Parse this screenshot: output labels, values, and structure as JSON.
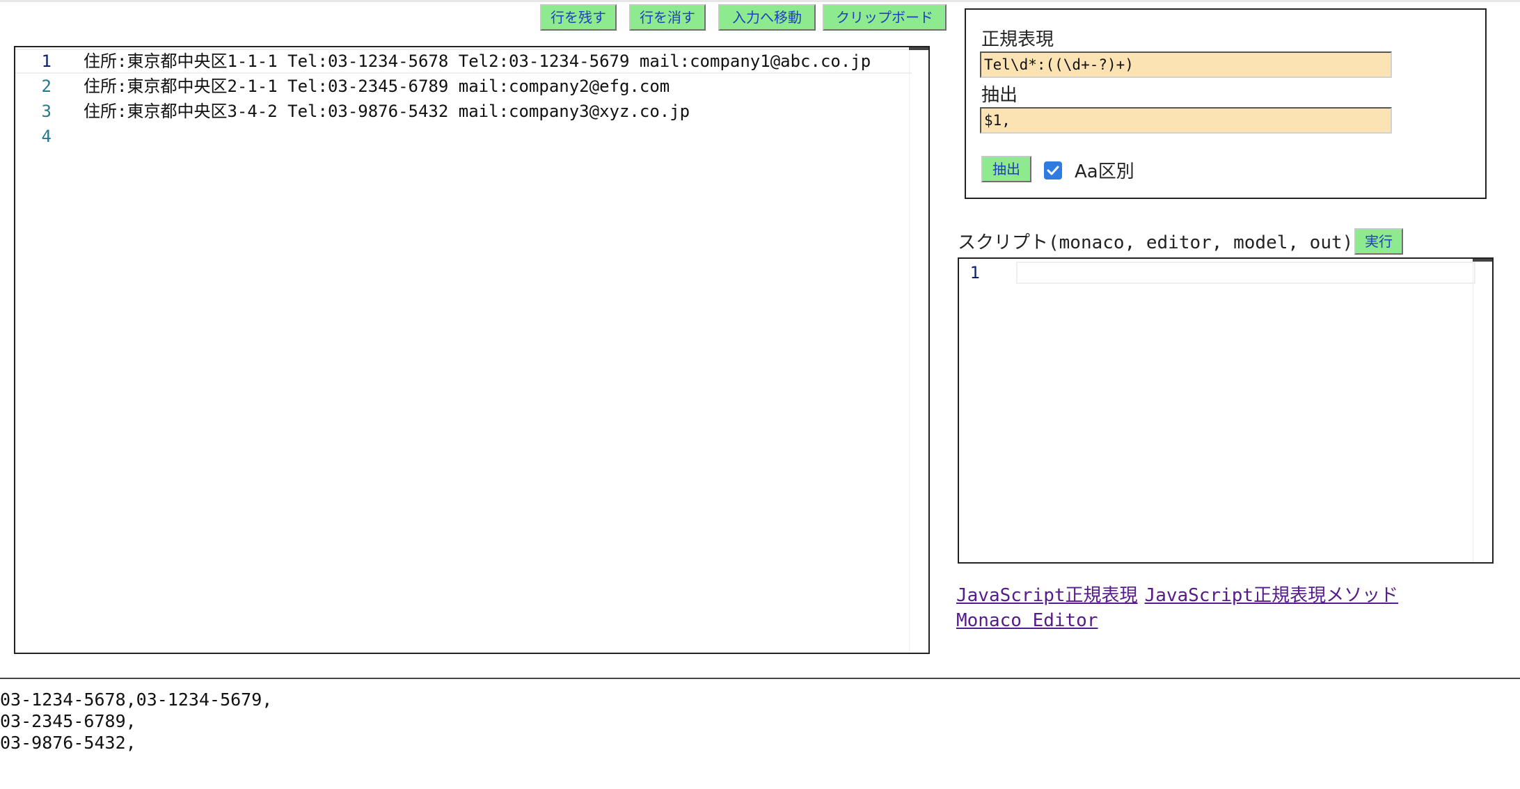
{
  "toolbar": {
    "keep_lines": "行を残す",
    "delete_lines": "行を消す",
    "move_to_input": "入力へ移動",
    "clipboard": "クリップボード"
  },
  "main_editor": {
    "lines": [
      {
        "number": "1",
        "text": "住所:東京都中央区1-1-1 Tel:03-1234-5678 Tel2:03-1234-5679 mail:company1@abc.co.jp"
      },
      {
        "number": "2",
        "text": "住所:東京都中央区2-1-1 Tel:03-2345-6789 mail:company2@efg.com"
      },
      {
        "number": "3",
        "text": "住所:東京都中央区3-4-2 Tel:03-9876-5432 mail:company3@xyz.co.jp"
      },
      {
        "number": "4",
        "text": ""
      }
    ]
  },
  "regex_panel": {
    "regex_label": "正規表現",
    "regex_value": "Tel\\d*:((\\d+-?)+)",
    "extract_label": "抽出",
    "extract_value": "$1,",
    "extract_button": "抽出",
    "case_sensitive_label": "Aa区別",
    "case_sensitive_checked": true
  },
  "script": {
    "label": "スクリプト(monaco, editor, model, out)",
    "run_button": "実行",
    "lines": [
      {
        "number": "1",
        "text": ""
      }
    ]
  },
  "links": {
    "regex": "JavaScript正規表現",
    "regex_methods": "JavaScript正規表現メソッド",
    "monaco": "Monaco Editor"
  },
  "output": {
    "lines": [
      "03-1234-5678,03-1234-5679,",
      "03-2345-6789,",
      "03-9876-5432,"
    ]
  },
  "colors": {
    "button_bg": "#8eea8e",
    "button_text": "#1f3fbf",
    "input_bg": "#fbe3b4",
    "link": "#551a8b",
    "checkbox": "#2f7be0",
    "line_number": "#237893"
  }
}
